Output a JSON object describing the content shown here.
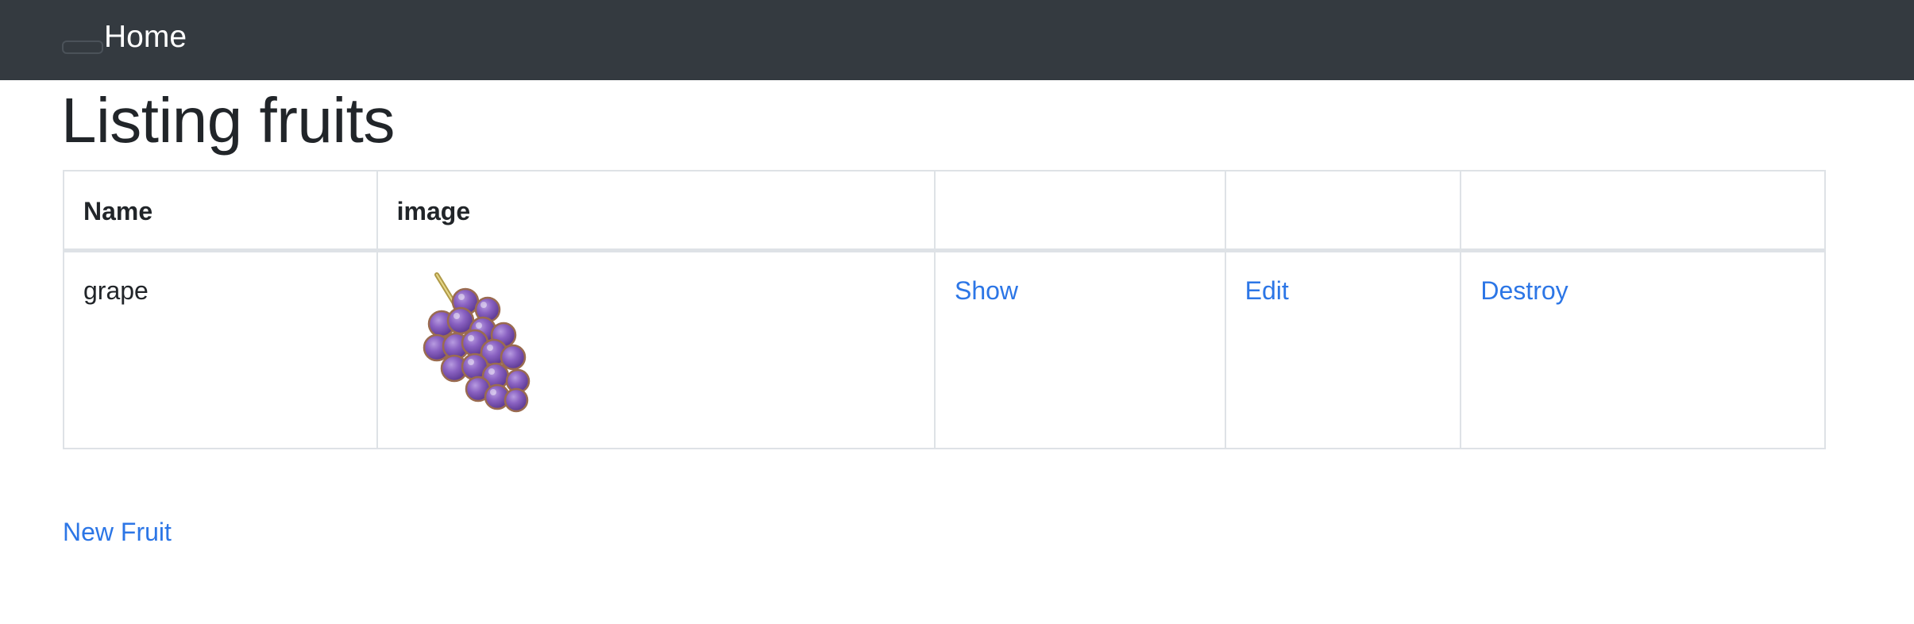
{
  "navbar": {
    "brand": "Home",
    "toggler_icon": "hamburger-menu-icon"
  },
  "page": {
    "title": "Listing fruits"
  },
  "table": {
    "headers": [
      "Name",
      "image",
      "",
      "",
      ""
    ],
    "rows": [
      {
        "name": "grape",
        "image_icon": "grape-icon",
        "show_label": "Show",
        "edit_label": "Edit",
        "destroy_label": "Destroy"
      }
    ]
  },
  "actions": {
    "new_label": "New Fruit"
  },
  "colors": {
    "navbar_bg": "#343a40",
    "link": "#2c76e6",
    "border": "#dee2e6",
    "text": "#212529"
  }
}
